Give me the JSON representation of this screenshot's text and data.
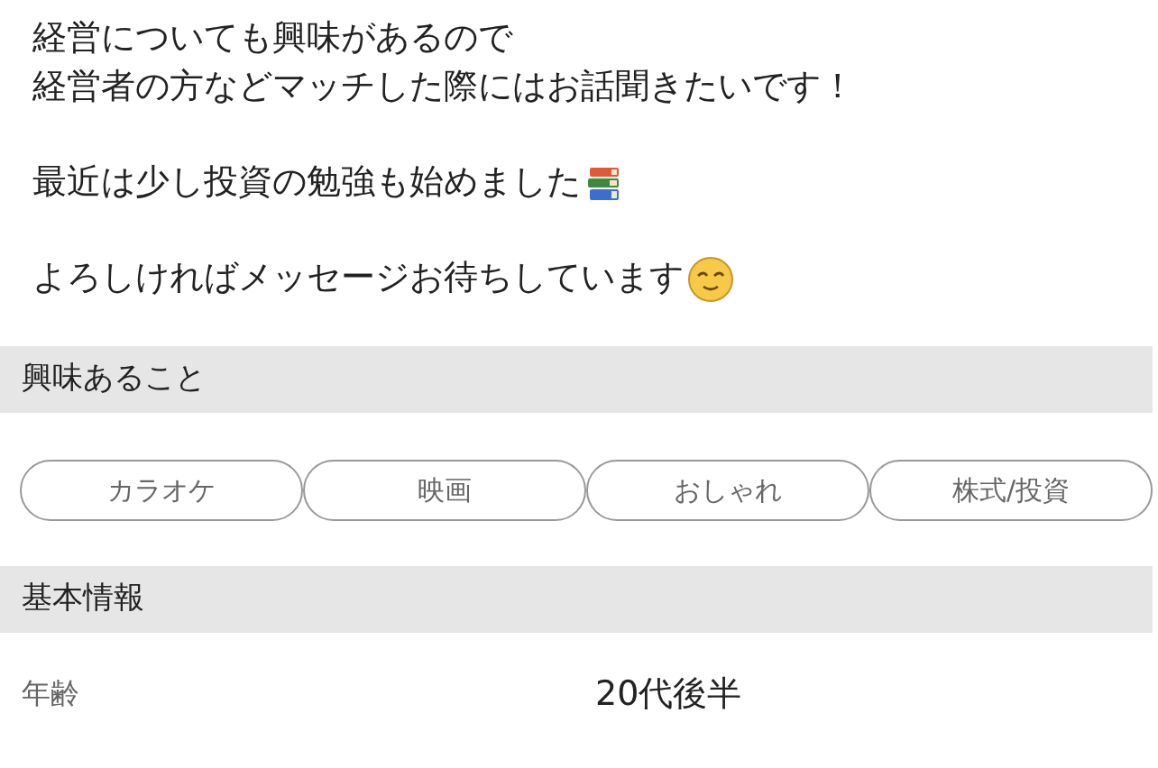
{
  "intro": {
    "paragraphs": [
      {
        "lines": [
          "経営についても興味があるので",
          "経営者の方などマッチした際にはお話聞きたいです！"
        ]
      },
      {
        "lines": [
          "最近は少し投資の勉強も始めました"
        ]
      },
      {
        "lines": [
          "よろしければメッセージお待ちしています"
        ]
      }
    ]
  },
  "interests": {
    "title": "興味あること",
    "tags": [
      "カラオケ",
      "映画",
      "おしゃれ",
      "株式/投資"
    ]
  },
  "basic_info": {
    "title": "基本情報",
    "rows": [
      {
        "label": "年齢",
        "value": "20代後半"
      }
    ]
  }
}
